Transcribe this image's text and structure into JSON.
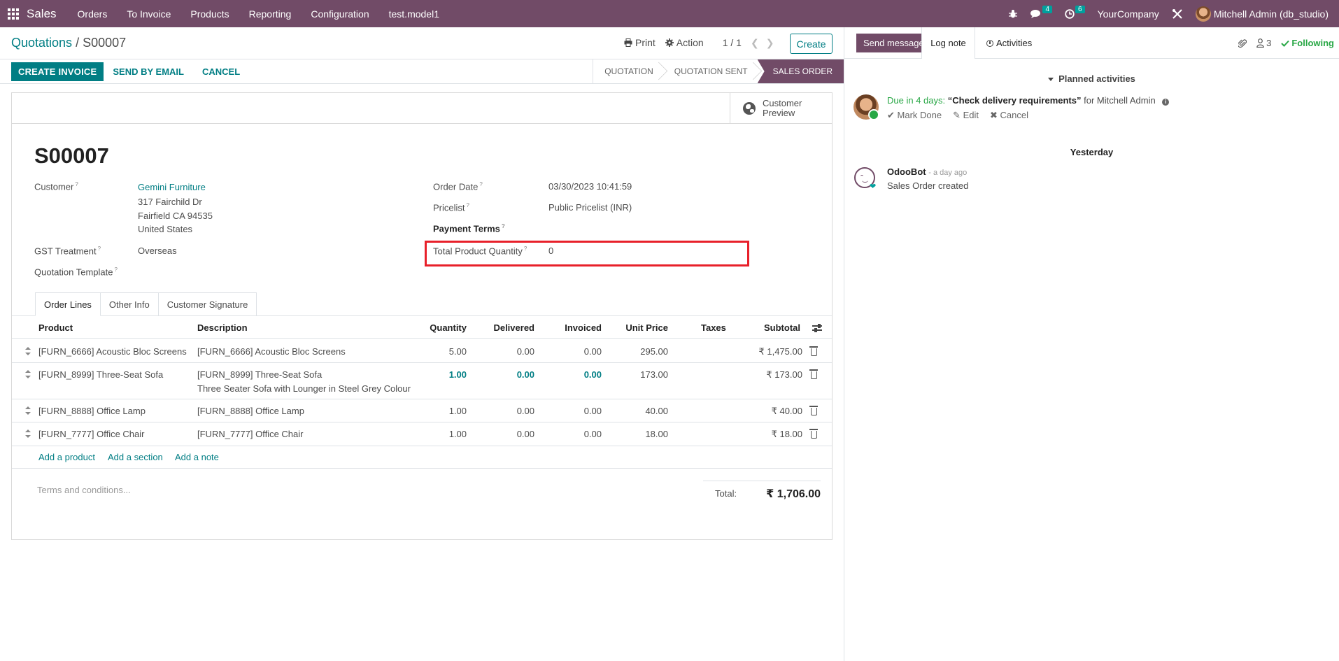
{
  "navbar": {
    "app_name": "Sales",
    "menu": [
      "Orders",
      "To Invoice",
      "Products",
      "Reporting",
      "Configuration",
      "test.model1"
    ],
    "messages_badge": "4",
    "activities_badge": "6",
    "company": "YourCompany",
    "user": "Mitchell Admin (db_studio)"
  },
  "control_panel": {
    "breadcrumb_parent": "Quotations",
    "breadcrumb_sep": "/",
    "breadcrumb_current": "S00007",
    "print_label": "Print",
    "action_label": "Action",
    "pager": "1 / 1",
    "create_label": "Create"
  },
  "statusbar": {
    "create_invoice": "CREATE INVOICE",
    "send_by_email": "SEND BY EMAIL",
    "cancel": "CANCEL",
    "stages": [
      "QUOTATION",
      "QUOTATION SENT",
      "SALES ORDER"
    ],
    "active_stage": "SALES ORDER"
  },
  "form": {
    "customer_preview_line1": "Customer",
    "customer_preview_line2": "Preview",
    "title": "S00007",
    "labels": {
      "customer": "Customer",
      "gst_treatment": "GST Treatment",
      "quotation_template": "Quotation Template",
      "order_date": "Order Date",
      "pricelist": "Pricelist",
      "payment_terms": "Payment Terms",
      "total_product_quantity": "Total Product Quantity"
    },
    "help_mark": "?",
    "customer_name": "Gemini Furniture",
    "customer_address": [
      "317 Fairchild Dr",
      "Fairfield CA 94535",
      "United States"
    ],
    "gst_treatment": "Overseas",
    "order_date": "03/30/2023 10:41:59",
    "pricelist": "Public Pricelist (INR)",
    "total_product_quantity": "0",
    "tabs": [
      "Order Lines",
      "Other Info",
      "Customer Signature"
    ],
    "active_tab": "Order Lines"
  },
  "order_lines": {
    "columns": [
      "Product",
      "Description",
      "Quantity",
      "Delivered",
      "Invoiced",
      "Unit Price",
      "Taxes",
      "Subtotal"
    ],
    "rows": [
      {
        "product": "[FURN_6666] Acoustic Bloc Screens",
        "description": "[FURN_6666] Acoustic Bloc Screens",
        "description2": "",
        "quantity": "5.00",
        "delivered": "0.00",
        "invoiced": "0.00",
        "unit_price": "295.00",
        "taxes": "",
        "subtotal": "₹ 1,475.00"
      },
      {
        "product": "[FURN_8999] Three-Seat Sofa",
        "description": "[FURN_8999] Three-Seat Sofa",
        "description2": "Three Seater Sofa with Lounger in Steel Grey Colour",
        "quantity": "1.00",
        "delivered": "0.00",
        "invoiced": "0.00",
        "unit_price": "173.00",
        "taxes": "",
        "subtotal": "₹ 173.00"
      },
      {
        "product": "[FURN_8888] Office Lamp",
        "description": "[FURN_8888] Office Lamp",
        "description2": "",
        "quantity": "1.00",
        "delivered": "0.00",
        "invoiced": "0.00",
        "unit_price": "40.00",
        "taxes": "",
        "subtotal": "₹ 40.00"
      },
      {
        "product": "[FURN_7777] Office Chair",
        "description": "[FURN_7777] Office Chair",
        "description2": "",
        "quantity": "1.00",
        "delivered": "0.00",
        "invoiced": "0.00",
        "unit_price": "18.00",
        "taxes": "",
        "subtotal": "₹ 18.00"
      }
    ],
    "add_product": "Add a product",
    "add_section": "Add a section",
    "add_note": "Add a note",
    "terms_placeholder": "Terms and conditions...",
    "total_label": "Total:",
    "total_value": "₹ 1,706.00"
  },
  "chatter": {
    "send_message": "Send message",
    "log_note": "Log note",
    "activities": "Activities",
    "followers_count": "3",
    "following": "Following",
    "planned_activities": "Planned activities",
    "due_text": "Due in 4 days:",
    "activity_summary": "“Check delivery requirements”",
    "activity_for": "for Mitchell Admin",
    "mark_done": "Mark Done",
    "edit": "Edit",
    "cancel": "Cancel",
    "date_separator": "Yesterday",
    "bot_name": "OdooBot",
    "bot_time": "- a day ago",
    "bot_message": "Sales Order created"
  },
  "colors": {
    "brand": "#714b67",
    "accent": "#017e84",
    "highlight": "#e8202a",
    "success": "#28a745"
  }
}
